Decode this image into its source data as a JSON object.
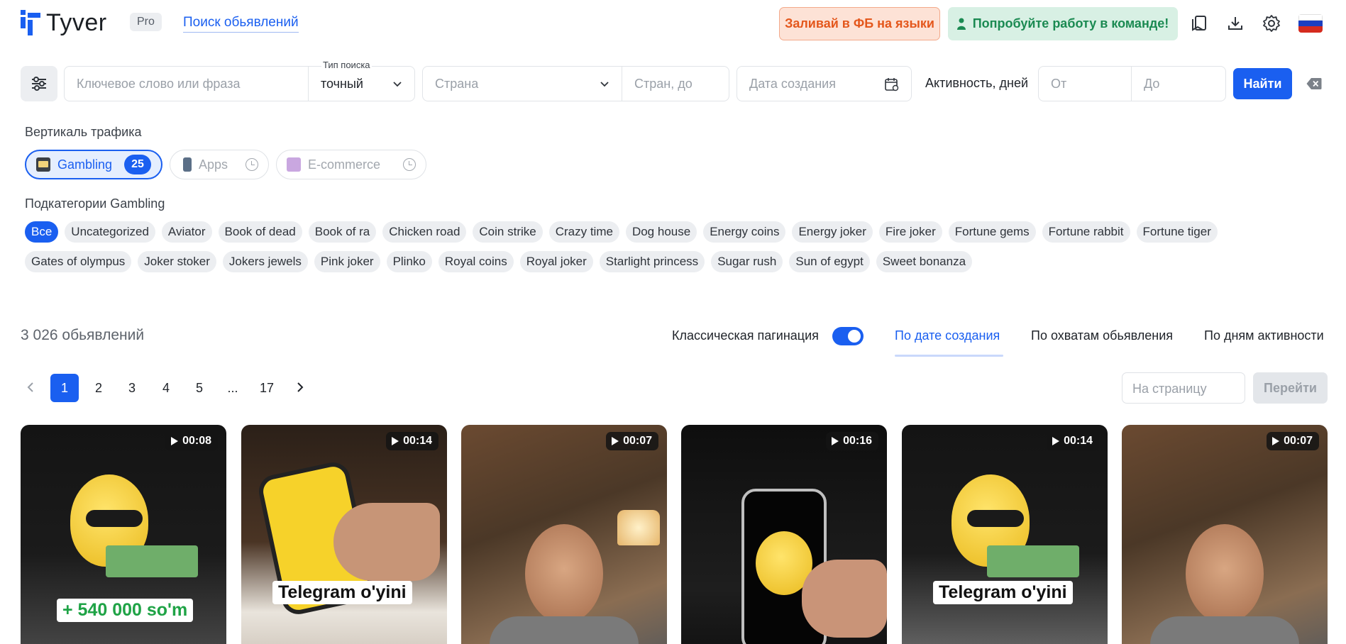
{
  "header": {
    "brand": "Tyver",
    "plan": "Pro",
    "nav_link": "Поиск обьявлений",
    "fb_button": "Заливай в ФБ на языки",
    "team_button": "Попробуйте работу в команде!",
    "icons": [
      "bookmarks-icon",
      "download-icon",
      "settings-icon"
    ],
    "language_flag": "ru-flag"
  },
  "search": {
    "keyword_placeholder": "Ключевое слово или фраза",
    "type_label": "Тип поиска",
    "type_value": "точный",
    "country_placeholder": "Страна",
    "countries_to_placeholder": "Стран, до",
    "date_placeholder": "Дата создания",
    "activity_label": "Активность, дней",
    "activity_from": "От",
    "activity_to": "До",
    "find_button": "Найти"
  },
  "verticals": {
    "label": "Вертикаль трафика",
    "items": [
      {
        "name": "Gambling",
        "count": "25",
        "active": true
      },
      {
        "name": "Apps",
        "active": false
      },
      {
        "name": "E-commerce",
        "active": false
      }
    ]
  },
  "subcategories": {
    "label": "Подкатегории Gambling",
    "row1": [
      "Все",
      "Uncategorized",
      "Aviator",
      "Book of dead",
      "Book of ra",
      "Chicken road",
      "Coin strike",
      "Crazy time",
      "Dog house",
      "Energy coins",
      "Energy joker",
      "Fire joker",
      "Fortune gems",
      "Fortune rabbit",
      "Fortune tiger"
    ],
    "row2": [
      "Gates of olympus",
      "Joker stoker",
      "Jokers jewels",
      "Pink joker",
      "Plinko",
      "Royal coins",
      "Royal joker",
      "Starlight princess",
      "Sugar rush",
      "Sun of egypt",
      "Sweet bonanza"
    ],
    "active": "Все"
  },
  "results": {
    "count": "3 026 обьявлений",
    "pagination_label": "Классическая пагинация",
    "pagination_enabled": true,
    "sort_tabs": [
      "По дате создания",
      "По охватам обьявления",
      "По дням активности"
    ],
    "active_sort": "По дате создания"
  },
  "pagination": {
    "pages": [
      "1",
      "2",
      "3",
      "4",
      "5",
      "...",
      "17"
    ],
    "current": "1",
    "per_page_placeholder": "На страницу",
    "go_button": "Перейти"
  },
  "cards": [
    {
      "duration": "00:08",
      "overlay": "+ 540 000 so'm"
    },
    {
      "duration": "00:14",
      "overlay": "Telegram o'yini"
    },
    {
      "duration": "00:07",
      "overlay": ""
    },
    {
      "duration": "00:16",
      "overlay": ""
    },
    {
      "duration": "00:14",
      "overlay": "Telegram o'yini"
    },
    {
      "duration": "00:07",
      "overlay": ""
    }
  ],
  "colors": {
    "accent": "#1a5ff0",
    "fb_bg": "#fde2d6",
    "fb_text": "#e4571c",
    "team_bg": "#d8f0e4",
    "team_text": "#1b8a52"
  }
}
